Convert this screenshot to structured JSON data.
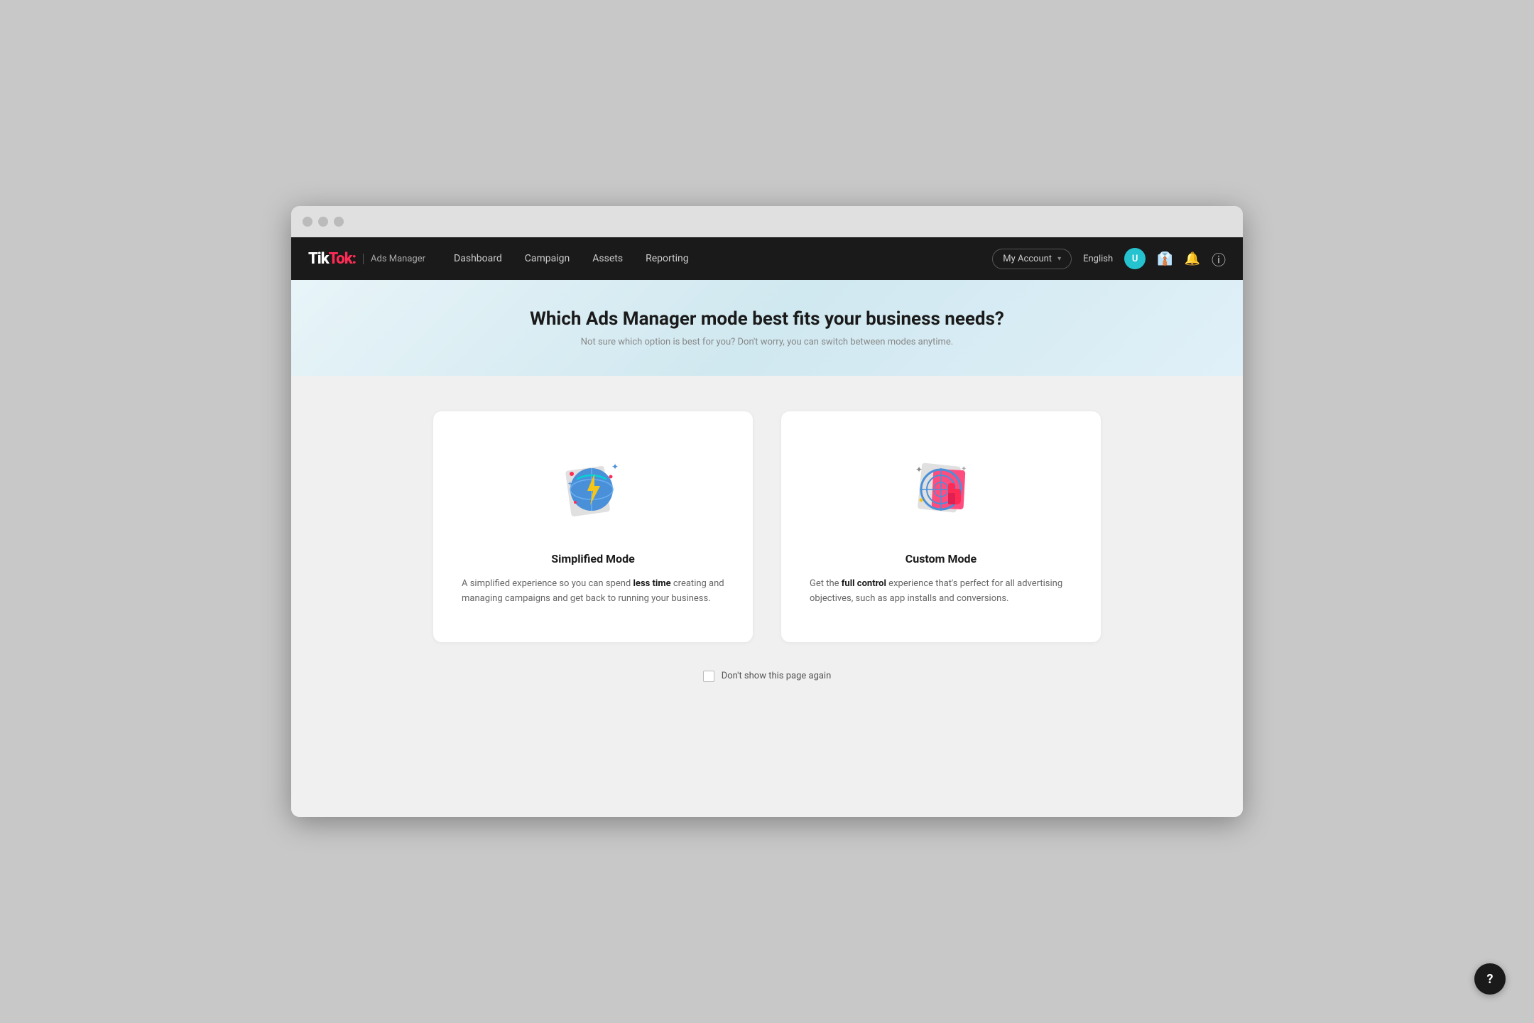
{
  "browser": {
    "dots": [
      "dot1",
      "dot2",
      "dot3"
    ]
  },
  "navbar": {
    "logo": "TikTok",
    "logo_dot": ":",
    "ads_manager": "Ads Manager",
    "links": [
      {
        "label": "Dashboard",
        "key": "dashboard"
      },
      {
        "label": "Campaign",
        "key": "campaign"
      },
      {
        "label": "Assets",
        "key": "assets"
      },
      {
        "label": "Reporting",
        "key": "reporting"
      }
    ],
    "my_account_label": "My Account",
    "lang_label": "English",
    "user_initial": "U"
  },
  "hero": {
    "title": "Which Ads Manager mode best fits your business needs?",
    "subtitle": "Not sure which option is best for you? Don't worry, you can switch between modes anytime."
  },
  "simplified_mode": {
    "title": "Simplified Mode",
    "description_prefix": "A simplified experience so you can spend ",
    "description_bold": "less time",
    "description_suffix": " creating and managing campaigns and get back to running your business."
  },
  "custom_mode": {
    "title": "Custom Mode",
    "description_prefix": "Get the ",
    "description_bold": "full control",
    "description_suffix": " experience that's perfect for all advertising objectives, such as app installs and conversions."
  },
  "footer_checkbox": {
    "label": "Don't show this page again"
  },
  "icons": {
    "chevron_down": "▾",
    "briefcase": "💼",
    "bell": "🔔",
    "question": "?"
  }
}
